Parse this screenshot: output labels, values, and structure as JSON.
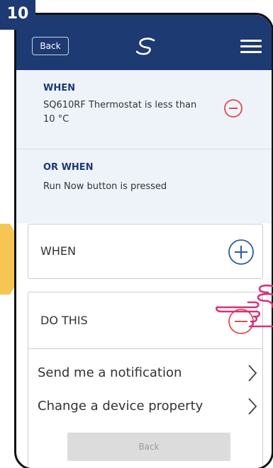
{
  "step": {
    "number": "10"
  },
  "header": {
    "back_label": "Back",
    "logo_icon": "salus-logo-icon",
    "menu_icon": "hamburger-menu-icon"
  },
  "conditions": [
    {
      "title": "WHEN",
      "text": "SQ610RF Thermostat is less than 10 °C"
    },
    {
      "title": "OR WHEN",
      "text": "Run Now button is pressed"
    }
  ],
  "when_section": {
    "label": "WHEN"
  },
  "do_section": {
    "label": "DO THIS",
    "actions": [
      {
        "label": "Send me a notification"
      },
      {
        "label": "Change a device property"
      }
    ]
  },
  "footer": {
    "back_label": "Back"
  },
  "colors": {
    "header": "#1e3a73",
    "accent_blue": "#2a5aa8",
    "remove_red": "#e14b4b",
    "arrow_yellow": "#f7c553",
    "hand_pink": "#d4327c"
  }
}
